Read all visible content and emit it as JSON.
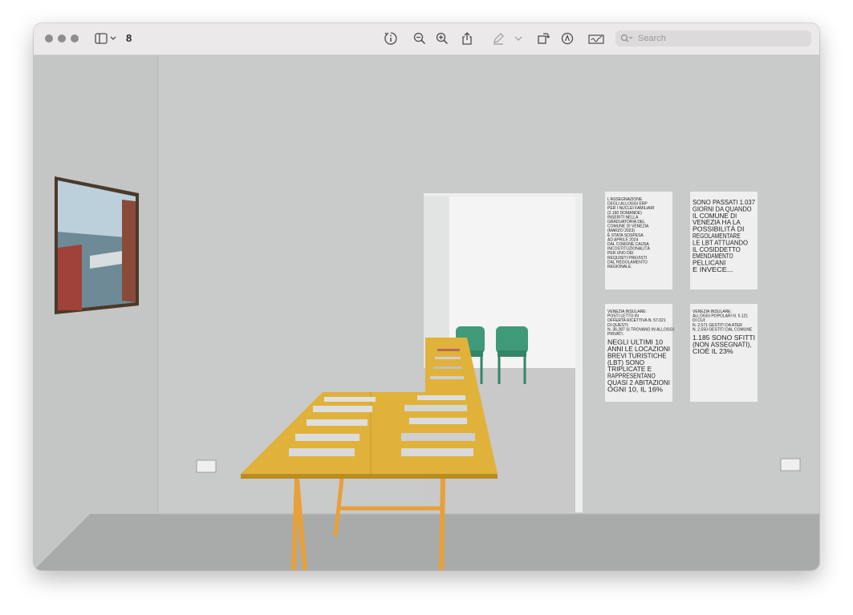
{
  "window": {
    "page_count": "8"
  },
  "toolbar": {
    "search_placeholder": "Search"
  },
  "posters": [
    {
      "small_lines": [
        "L'ASSEGNAZIONE",
        "DEGLI ALLOGGI ERP",
        "PER I NUCLEI FAMILIARI",
        "(2.160 DOMANDE)",
        "INSERITI NELLA",
        "GRADUATORIA DEL",
        "COMUNE DI VENEZIA",
        "(MARZO 2023)",
        "È STATA SOSPESA",
        "AD APRILE 2024",
        "DAL COMUNE CAUSA",
        "INCOSTITUZIONALITÀ",
        "PER UNO DEI",
        "REQUISITI PREVISTI",
        "DAL REGOLAMENTO",
        "REGIONALE."
      ],
      "big_lines": []
    },
    {
      "small_lines": [],
      "big_lines": [
        "SONO PASSATI 1.037",
        "GIORNI DA QUANDO",
        "IL COMUNE DI",
        "VENEZIA HA LA",
        "POSSIBILITÀ DI",
        "REGOLAMENTARE",
        "LE LBT ATTUANDO",
        "IL COSIDDETTO",
        "EMENDAMENTO",
        "PELLICANI",
        "E INVECE..."
      ]
    },
    {
      "small_lines": [
        "VENEZIA INSULARE:",
        "POSTI LETTO IN",
        "OFFERTA RICETTIVA N. 57.021",
        "DI QUESTI:",
        "N. 36.287 SI TROVANO IN ALLOGGI",
        "PRIVATI."
      ],
      "big_lines": [
        "NEGLI ULTIMI 10",
        "ANNI LE LOCAZIONI",
        "BREVI TURISTICHE",
        "(LBT) SONO",
        "TRIPLICATE E",
        "RAPPRESENTANO",
        "QUASI 2 ABITAZIONI",
        "OGNI 10, IL 16%"
      ]
    },
    {
      "small_lines": [
        "VENEZIA INSULARE:",
        "ALLOGGI POPOLARI N. 5.121",
        "DI CUI:",
        "N. 2.571 GESTITI DA ATER",
        "N. 2.550 GESTITI DAL COMUNE"
      ],
      "big_lines": [
        "1.185 SONO SFITTI",
        "(NON ASSEGNATI),",
        "CIOÈ IL 23%"
      ]
    }
  ],
  "icons": {
    "sidebar": "sidebar-icon",
    "info": "info-icon",
    "zoom_out": "zoom-out-icon",
    "zoom_in": "zoom-in-icon",
    "share": "share-icon",
    "markup_pen": "pen-icon",
    "rotate": "rotate-icon",
    "markup": "markup-icon",
    "signature": "signature-icon",
    "search": "search-icon"
  },
  "colors": {
    "toolbar_bg": "#ebe9ea",
    "wall": "#c8cac9",
    "table": "#e0b23a",
    "chairs": "#3f9a7a"
  }
}
